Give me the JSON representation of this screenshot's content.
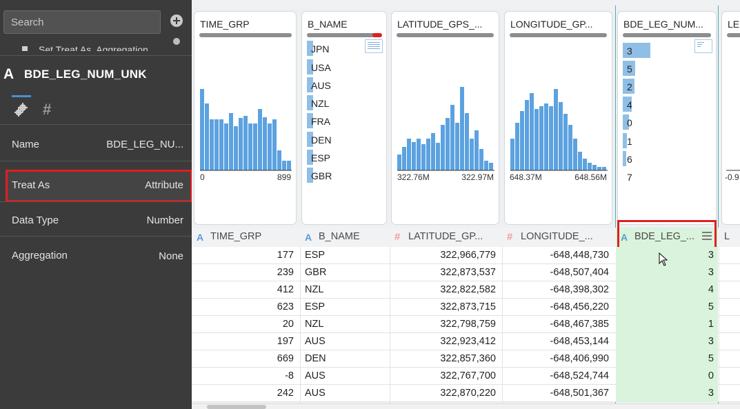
{
  "search": {
    "placeholder": "Search"
  },
  "partial_menu_item": "Set Treat As, Aggregation",
  "column": {
    "title": "BDE_LEG_NUM_UNK"
  },
  "properties": [
    {
      "label": "Name",
      "value": "BDE_LEG_NU..."
    },
    {
      "label": "Treat As",
      "value": "Attribute"
    },
    {
      "label": "Data Type",
      "value": "Number"
    },
    {
      "label": "Aggregation",
      "value": "None"
    }
  ],
  "cards": {
    "time_grp": {
      "title": "TIME_GRP",
      "min": "0",
      "max": "899"
    },
    "b_name": {
      "title": "B_NAME",
      "items": [
        "JPN",
        "USA",
        "AUS",
        "NZL",
        "FRA",
        "DEN",
        "ESP",
        "GBR"
      ]
    },
    "latitude": {
      "title": "LATITUDE_GPS_...",
      "min": "322.76M",
      "max": "322.97M"
    },
    "longitude": {
      "title": "LONGITUDE_GP...",
      "min": "648.37M",
      "max": "648.56M"
    },
    "bde": {
      "title": "BDE_LEG_NUM...",
      "items": [
        "3",
        "5",
        "2",
        "4",
        "0",
        "1",
        "6",
        "7"
      ]
    },
    "partial": {
      "title": "LEI",
      "min": "-0.9"
    }
  },
  "headers": [
    "TIME_GRP",
    "B_NAME",
    "LATITUDE_GP...",
    "LONGITUDE_...",
    "BDE_LEG_...",
    "L"
  ],
  "rows": [
    [
      "177",
      "ESP",
      "322,966,779",
      "-648,448,730",
      "3"
    ],
    [
      "239",
      "GBR",
      "322,873,537",
      "-648,507,404",
      "3"
    ],
    [
      "412",
      "NZL",
      "322,822,582",
      "-648,398,302",
      "4"
    ],
    [
      "623",
      "ESP",
      "322,873,715",
      "-648,456,220",
      "5"
    ],
    [
      "20",
      "NZL",
      "322,798,759",
      "-648,467,385",
      "1"
    ],
    [
      "197",
      "AUS",
      "322,923,412",
      "-648,453,144",
      "3"
    ],
    [
      "669",
      "DEN",
      "322,857,360",
      "-648,406,990",
      "5"
    ],
    [
      "-8",
      "AUS",
      "322,767,700",
      "-648,524,744",
      "0"
    ],
    [
      "242",
      "AUS",
      "322,870,220",
      "-648,501,367",
      "3"
    ]
  ],
  "colors": {
    "panel_bg": "#3b3b3c",
    "accent": "#4a90d0",
    "highlight": "#e01e1e",
    "selected_col": "#d9f3dc",
    "bar": "#5ca2e0"
  }
}
